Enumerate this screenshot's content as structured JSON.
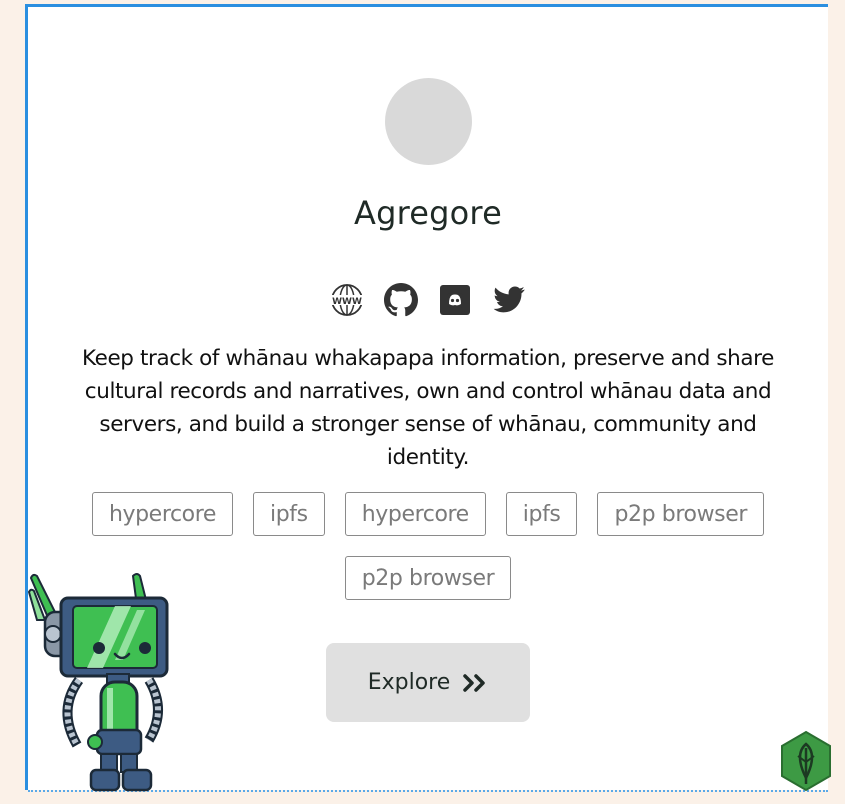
{
  "profile": {
    "title": "Agregore",
    "description": "Keep track of whānau whakapapa information, preserve and share cultural records and narratives, own and control whānau data and servers, and build a stronger sense of whānau, community and identity."
  },
  "social_icons": [
    "globe-www-icon",
    "github-icon",
    "discord-icon",
    "twitter-icon"
  ],
  "tags": [
    "hypercore",
    "ipfs",
    "hypercore",
    "ipfs",
    "p2p browser",
    "p2p browser"
  ],
  "explore_button": {
    "label": "Explore"
  },
  "colors": {
    "page_background": "#fbf1e8",
    "card_border": "#2b8fe0",
    "avatar_placeholder": "#d9d9d9",
    "button_background": "#e0e0e0",
    "robot_green": "#3fbf52"
  }
}
